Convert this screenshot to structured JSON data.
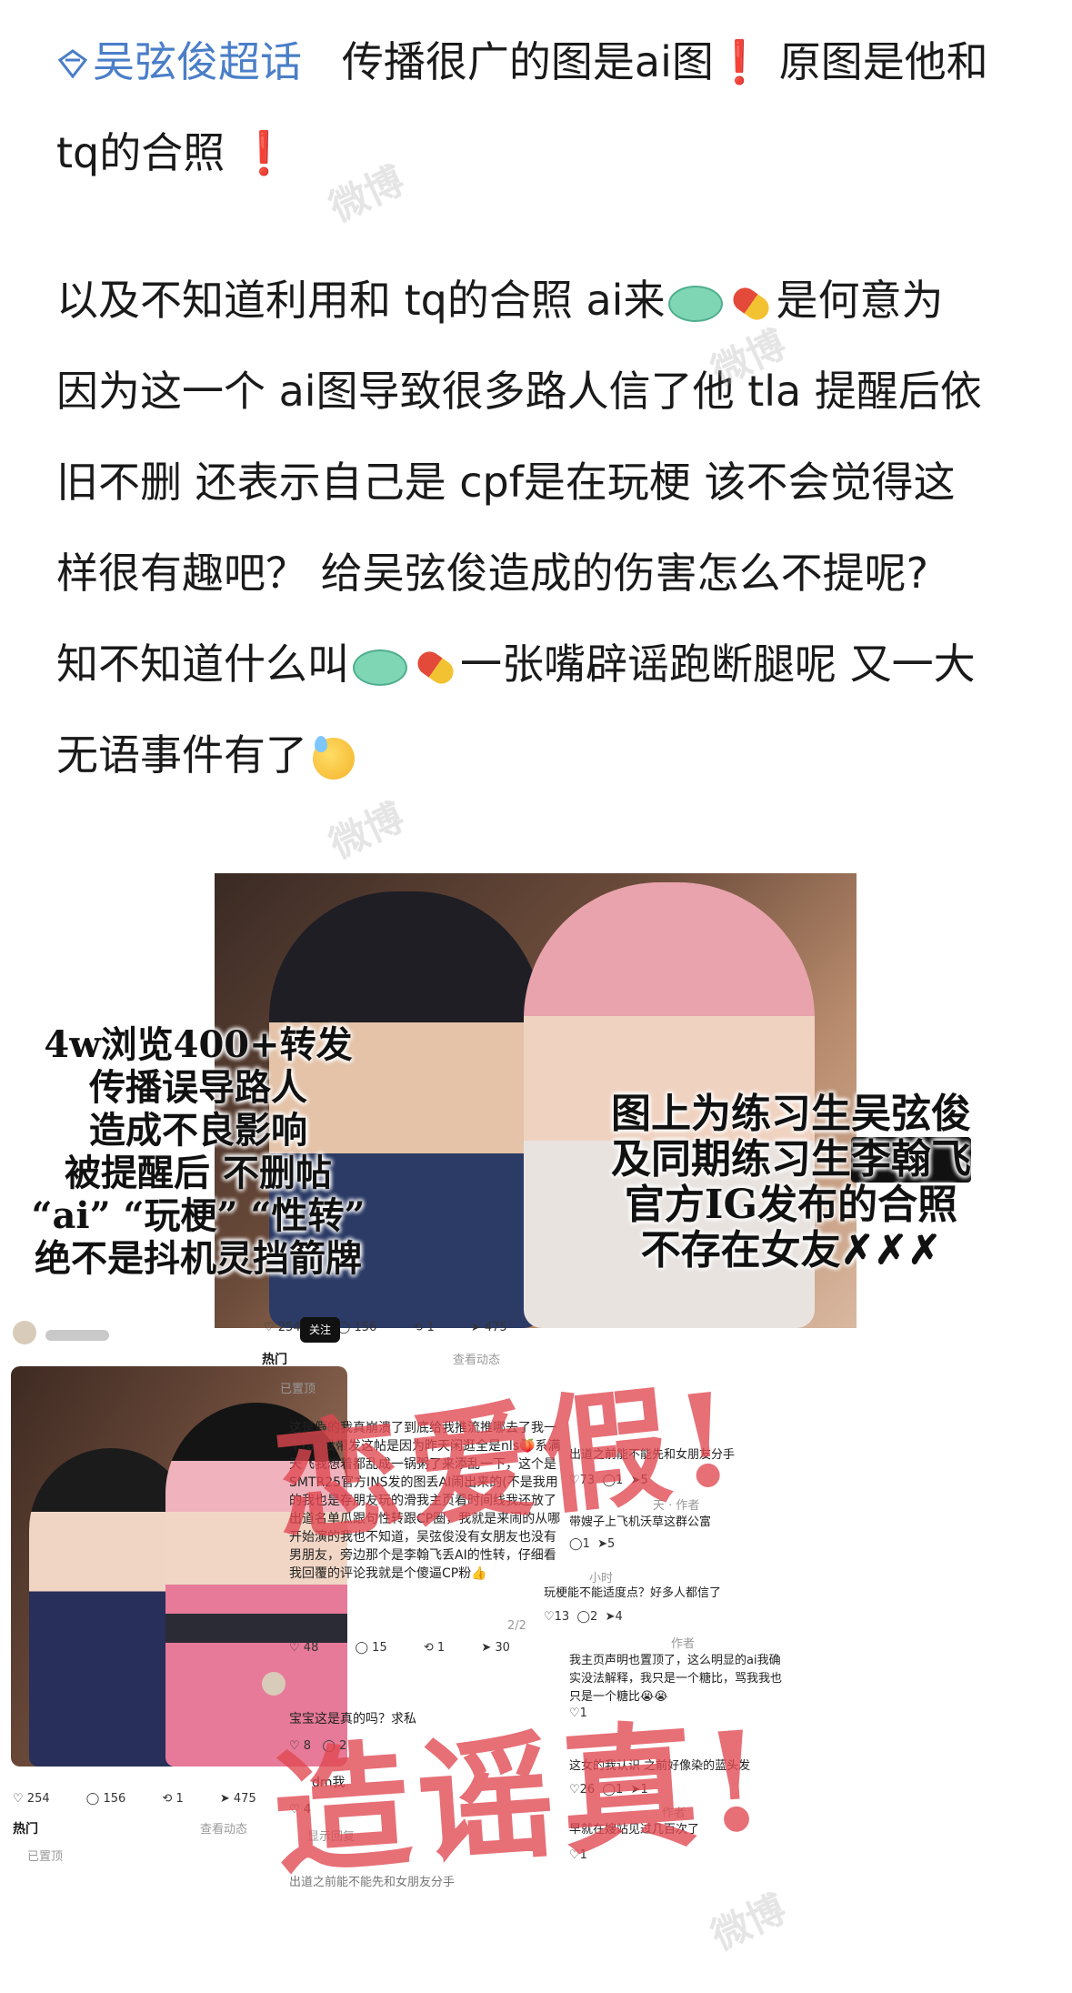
{
  "post": {
    "topic": "吴弦俊超话",
    "line1_text": "传播很广的图是ai图",
    "line1_text2": "原图是他和",
    "line2_text": "tq的合照",
    "exclaim": "❗",
    "para2": {
      "l1a": "以及不知道利用和 tq的合照 ai来",
      "l1b": "是何意为",
      "l2": "因为这一个 ai图导致很多路人信了他 tla 提醒后依",
      "l3": "旧不删 还表示自己是 cpf是在玩梗 该不会觉得这",
      "l4": "样很有趣吧？ 给吴弦俊造成的伤害怎么不提呢?",
      "l5a": "知不知道什么叫",
      "l5b": "一张嘴辟谣跑断腿呢 又一大",
      "l6": "无语事件有了"
    }
  },
  "image": {
    "overlay_left": [
      "4w浏览400+转发",
      "传播误导路人",
      "造成不良影响",
      "被提醒后   不删帖",
      "“ai”  “玩梗”  “性转”",
      "绝不是抖机灵挡箭牌"
    ],
    "overlay_right": [
      "图上为练习生吴弦俊",
      "及同期练习生",
      "官方IG发布的合照",
      "不存在女友"
    ],
    "overlay_right_xs": "✗✗✗",
    "stamp_top": "恋爱假!",
    "stamp_bottom": "造谣真!",
    "follow": "关注",
    "stats_top": {
      "likes": "254",
      "comments": "156",
      "reposts": "1",
      "shares": "475"
    },
    "stats_bottom": {
      "likes": "254",
      "comments": "156",
      "reposts": "1",
      "shares": "475"
    },
    "hot_label": "热门",
    "view_replies": "查看动态",
    "pinned": "已置顶",
    "main_comment": "这是假的我真崩溃了到底给我推流推哪去了我一个tag没带发这帖是因为昨天闲逛全是nls🍑系满天飞我想着都乱成一锅粥了来添乱一下，这个是SMTR25官方INS发的图丢AI闹出来的(不是我用的我也是存朋友玩的滑我主页看时间线我还放了出道名单瓜跟句性转跟CP圈，我就是来闹的从哪开始演的我也不知道，吴弦俊没有女朋友也没有男朋友，旁边那个是李翰飞丢AI的性转，仔细看我回覆的评论我就是个傻逼CP粉👍",
    "main_page": "2/2",
    "main_stats": {
      "likes": "48",
      "comments": "15",
      "reposts": "1",
      "shares": "30"
    },
    "c_baby": "宝宝这是真的吗？求私",
    "c_baby_likes": "8",
    "c_baby_comments": "2",
    "c_dm": "dm我",
    "c_dm_likes": "4",
    "c_dm_reply": "显示回复",
    "author_tag": "作者",
    "r1": "出道之前能不能先和女朋友分手",
    "r1_likes": "73",
    "r1_c": "1",
    "r1_s": "5",
    "r2": "带嫂子上飞机沃草这群公富",
    "r2_c": "1",
    "r2_s": "5",
    "r3": "玩梗能不能适度点？好多人都信了",
    "r3_likes": "13",
    "r3_c": "2",
    "r3_s": "4",
    "r4": "我主页声明也置顶了，这么明显的ai我确实没法解释，我只是一个糖比，骂我我也只是一个糖比😭😭",
    "r4_likes": "1",
    "r5": "这女的我认识 之前好像染的蓝头发",
    "r5_likes": "26",
    "r5_c": "1",
    "r5_s": "1",
    "r6": "早就在嫂站见过几百次了",
    "r6_likes": "1",
    "time1": "小时",
    "time2": "天",
    "bottom_left_hot": "热门",
    "bottom_left_view": "查看动态",
    "bottom_pinned": "已置顶",
    "bottom_partial": "出道之前能不能先和女朋友分手"
  },
  "watermark": "微博"
}
